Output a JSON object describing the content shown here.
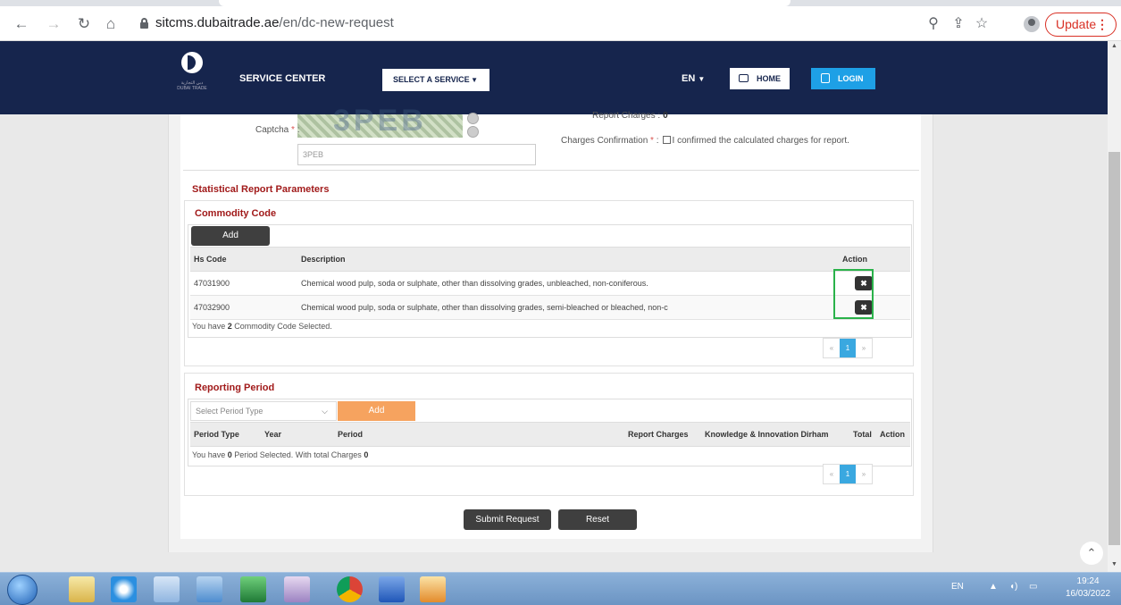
{
  "browser": {
    "url_host": "sitcms.dubaitrade.ae",
    "url_path": "/en/dc-new-request",
    "update_label": "Update"
  },
  "header": {
    "logo_text": "دبي التجارية\nDUBAI TRADE",
    "service_center": "SERVICE CENTER",
    "select_service": "SELECT A SERVICE",
    "lang": "EN",
    "home": "HOME",
    "login": "LOGIN"
  },
  "captcha": {
    "label": "Captcha",
    "input_value": "3PEB"
  },
  "charges": {
    "report_charges_label": "Report Charges :",
    "report_charges_value": "0",
    "confirm_label": "Charges Confirmation",
    "confirm_text": "I confirmed the calculated charges for report."
  },
  "statistical": {
    "title": "Statistical Report Parameters"
  },
  "commodity": {
    "title": "Commodity Code",
    "add_label": "Add",
    "columns": [
      "Hs Code",
      "Description",
      "Action"
    ],
    "rows": [
      {
        "code": "47031900",
        "description": "Chemical wood pulp, soda or sulphate, other than dissolving grades, unbleached, non-coniferous."
      },
      {
        "code": "47032900",
        "description": "Chemical wood pulp, soda or sulphate, other than dissolving grades, semi-bleached or bleached, non-c"
      }
    ],
    "count_prefix": "You have ",
    "count": "2",
    "count_suffix": " Commodity Code Selected.",
    "pager": {
      "prev": "«",
      "page": "1",
      "next": "»"
    }
  },
  "period": {
    "title": "Reporting Period",
    "select_placeholder": "Select Period Type",
    "add_label": "Add",
    "columns": [
      "Period Type",
      "Year",
      "Period",
      "Report Charges",
      "Knowledge & Innovation Dirham",
      "Total",
      "Action"
    ],
    "count_prefix": "You have ",
    "count": "0",
    "count_mid": " Period Selected. With total Charges ",
    "total": "0",
    "pager": {
      "prev": "«",
      "page": "1",
      "next": "»"
    }
  },
  "actions": {
    "submit": "Submit Request",
    "reset": "Reset"
  },
  "taskbar": {
    "lang": "EN",
    "time": "19:24",
    "date": "16/03/2022"
  },
  "colors": {
    "header_bg": "#16254d",
    "section_title": "#a11a1a",
    "login_btn": "#1ea0e6",
    "add_orange": "#f6a35f",
    "highlight": "#2ab24a"
  }
}
